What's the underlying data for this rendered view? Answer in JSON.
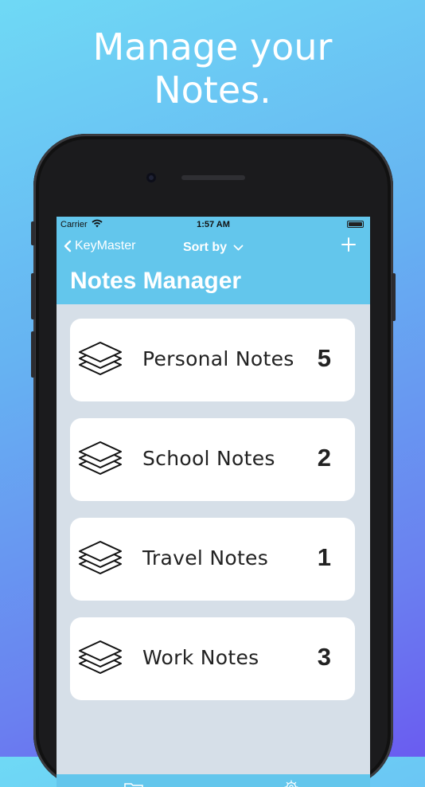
{
  "headline": {
    "line1": "Manage your",
    "line2": "Notes."
  },
  "status_bar": {
    "carrier": "Carrier",
    "time": "1:57 AM"
  },
  "nav": {
    "back_label": "KeyMaster",
    "sort_label": "Sort by",
    "title": "Notes Manager"
  },
  "categories": [
    {
      "name": "Personal Notes",
      "count": "5",
      "icon": "layers-icon"
    },
    {
      "name": "School Notes",
      "count": "2",
      "icon": "layers-icon"
    },
    {
      "name": "Travel Notes",
      "count": "1",
      "icon": "layers-icon"
    },
    {
      "name": "Work Notes",
      "count": "3",
      "icon": "layers-icon"
    }
  ],
  "tabbar": {
    "icons": [
      "folder-icon",
      "gear-icon"
    ]
  },
  "colors": {
    "accent": "#63c6ec",
    "list_background": "#d6dfe8",
    "card": "#ffffff",
    "text": "#222222"
  }
}
